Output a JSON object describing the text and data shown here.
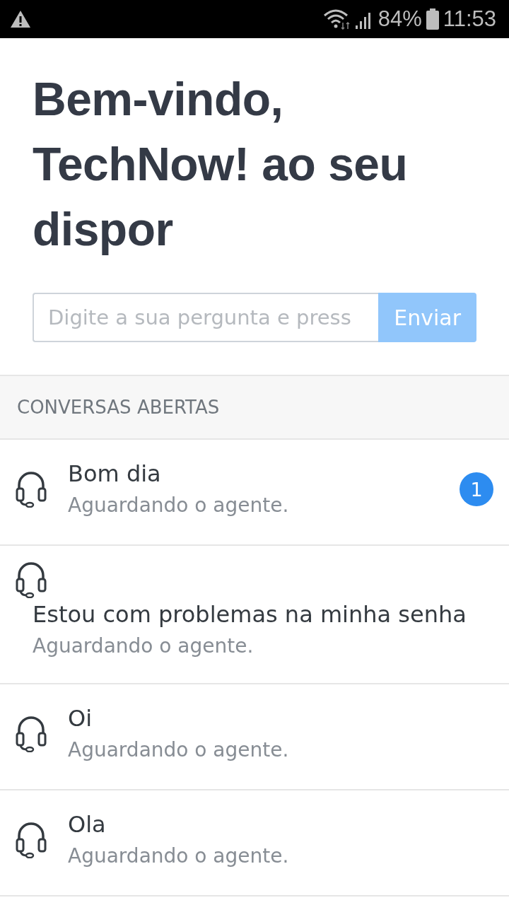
{
  "status_bar": {
    "battery": "84%",
    "time": "11:53"
  },
  "heading": "Bem-vindo, TechNow! ao seu dispor",
  "question": {
    "placeholder": "Digite a sua pergunta e press",
    "button": "Enviar"
  },
  "section": "CONVERSAS ABERTAS",
  "conversations": [
    {
      "title": "Bom dia",
      "subtitle": "Aguardando o agente.",
      "badge": "1"
    },
    {
      "title": "Estou com problemas na minha senha",
      "subtitle": "Aguardando o agente."
    },
    {
      "title": "Oi",
      "subtitle": "Aguardando o agente."
    },
    {
      "title": "Ola",
      "subtitle": "Aguardando o agente."
    }
  ]
}
